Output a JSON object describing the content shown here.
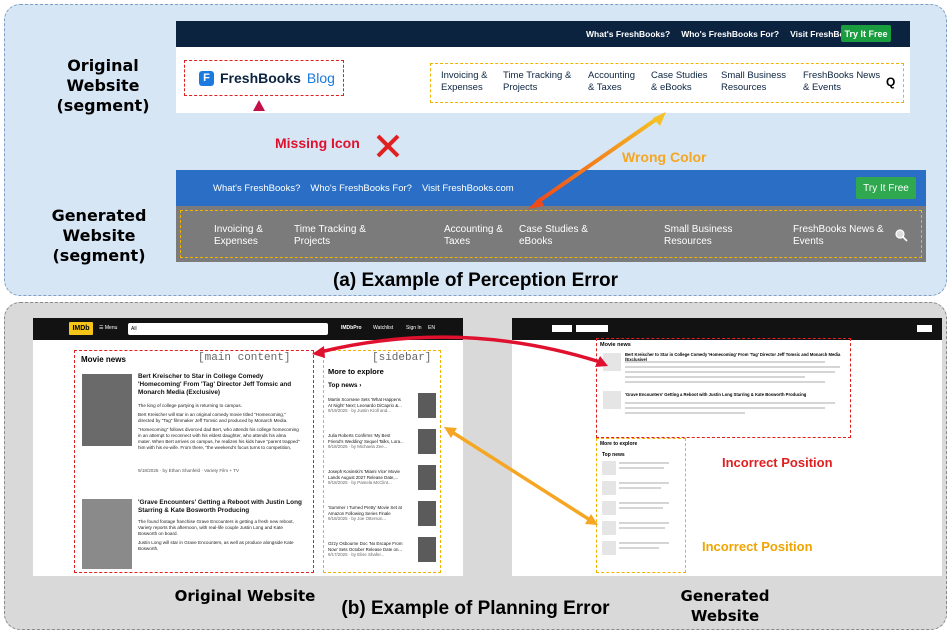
{
  "panel_a": {
    "caption": "(a) Example of Perception Error",
    "original_label_line1": "Original Website",
    "original_label_line2": "(segment)",
    "generated_label_line1": "Generated Website",
    "generated_label_line2": "(segment)",
    "original": {
      "top_links": [
        "What's FreshBooks?",
        "Who's FreshBooks For?",
        "Visit FreshBooks.com"
      ],
      "try_button": "Try It Free",
      "logo_letter": "F",
      "brand": "FreshBooks",
      "brand_suffix": "Blog",
      "nav": [
        {
          "l1": "Invoicing &",
          "l2": "Expenses"
        },
        {
          "l1": "Time Tracking &",
          "l2": "Projects"
        },
        {
          "l1": "Accounting",
          "l2": "& Taxes"
        },
        {
          "l1": "Case Studies",
          "l2": "& eBooks"
        },
        {
          "l1": "Small Business",
          "l2": "Resources"
        },
        {
          "l1": "FreshBooks News",
          "l2": "& Events"
        }
      ],
      "search_glyph": "Q"
    },
    "generated": {
      "top_links": [
        "What's FreshBooks?",
        "Who's FreshBooks For?",
        "Visit FreshBooks.com"
      ],
      "try_button": "Try It Free",
      "nav": [
        {
          "l1": "Invoicing &",
          "l2": "Expenses"
        },
        {
          "l1": "Time Tracking &",
          "l2": "Projects"
        },
        {
          "l1": "Accounting &",
          "l2": "Taxes"
        },
        {
          "l1": "Case Studies &",
          "l2": "eBooks"
        },
        {
          "l1": "Small Business",
          "l2": "Resources"
        },
        {
          "l1": "FreshBooks News &",
          "l2": "Events"
        }
      ]
    },
    "annotations": {
      "missing_icon": "Missing Icon",
      "wrong_color": "Wrong Color"
    },
    "colors": {
      "missing_icon": "#e0102f",
      "wrong_color": "#f5a623",
      "x_mark": "#e02020"
    }
  },
  "panel_b": {
    "caption": "(b) Example of Planning Error",
    "original_label": "Original Website",
    "generated_label": "Generated Website",
    "original": {
      "logo": "IMDb",
      "menu": "Menu",
      "all": "All",
      "pro": "IMDbPro",
      "watchlist": "Watchlist",
      "signin": "Sign In",
      "lang": "EN",
      "main_tag": "[main content]",
      "side_tag": "[sidebar]",
      "movie_news": "Movie news",
      "more_to_explore": "More to explore",
      "top_news": "Top news",
      "articles": [
        {
          "title": "Bert Kreischer to Star in College Comedy 'Homecoming' From 'Tag' Director Jeff Tomsic and Monarch Media (Exclusive)",
          "lines": [
            "The king of college partying is returning to campus.",
            "Bert Kreischer will star in an original comedy movie titled \"Homecoming,\"",
            "directed by \"Tag\" filmmaker Jeff Tomsic and produced by Monarch Media.",
            "\"Homecoming\" follows divorced dad Bert, who attends his college homecoming",
            "in an attempt to reconnect with his eldest daughter, who attends his alma",
            "mater. When Bert arrives on campus, he realizes his kids have \"parent trapped\"",
            "him with his ex-wife. From there, \"the weekend's focus turns to competition,"
          ],
          "meta": "9/18/2025 · by Ethan Shanfeld · Variety Film + TV"
        },
        {
          "title": "'Grave Encounters' Getting a Reboot with Justin Long Starring & Kate Bosworth Producing",
          "lines": [
            "The found footage franchise Grave Encounters is getting a fresh new reboot,",
            "Variety reports this afternoon, with real-life couple Justin Long and Kate",
            "Bosworth on board.",
            "Justin Long will star in Grave Encounters, as well as produce alongside Kate",
            "Bosworth."
          ]
        }
      ],
      "side_items": [
        {
          "l1": "Martin Scorsese Sets 'What Happens",
          "l2": "At Night' Next; Leonardo DiCaprio &...",
          "l3": "9/19/2025 · by Justin Kroll and..."
        },
        {
          "l1": "Julia Roberts Confirms 'My Best",
          "l2": "Friend's Wedding' Sequel Talks, Lora...",
          "l3": "9/18/2025 · by Michaela Zee..."
        },
        {
          "l1": "Joseph Kosinski's 'Miami Vice' Movie",
          "l2": "Lands August 2027 Release Date,...",
          "l3": "9/18/2025 · by Pamela McClint..."
        },
        {
          "l1": "'Summer I Turned Pretty' Movie Set at",
          "l2": "Amazon Following Series Finale",
          "l3": "9/18/2025 · by Joe Otterson..."
        },
        {
          "l1": "Ozzy Osbourne Doc 'No Escape From",
          "l2": "Now' Sets October Release Date on...",
          "l3": "9/17/2025 · by Elise Shafer..."
        }
      ]
    },
    "generated": {
      "movie_news": "Movie news",
      "article_titles": [
        "Bert Kreischer to Star in College Comedy 'Homecoming' From 'Tag' Director Jeff Tomsic and Monarch Media (Exclusive)",
        "'Grave Encounters' Getting a Reboot with Justin Long Starring & Kate Bosworth Producing"
      ],
      "more_to_explore": "More to explore",
      "top_news": "Top news"
    },
    "annotations": {
      "incorrect_position_1": "Incorrect Position",
      "incorrect_position_2": "Incorrect Position"
    },
    "colors": {
      "incorrect_1": "#e02020",
      "incorrect_2": "#f0a400"
    }
  }
}
